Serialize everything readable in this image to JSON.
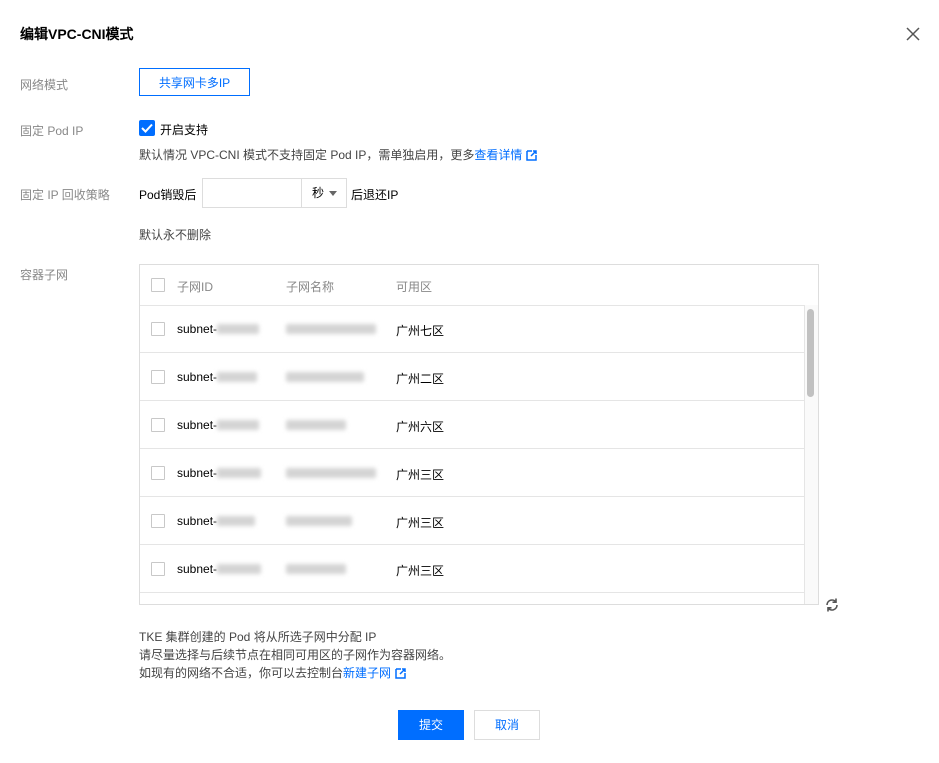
{
  "dialog": {
    "title": "编辑VPC-CNI模式",
    "close_icon": "close-icon"
  },
  "network_mode": {
    "label": "网络模式",
    "option": "共享网卡多IP"
  },
  "fixed_ip": {
    "label": "固定 Pod IP",
    "checkbox_label": "开启支持",
    "checked": true,
    "help_text": "默认情况 VPC-CNI 模式不支持固定 Pod IP，需单独启用，更多",
    "help_link": "查看详情"
  },
  "ip_recycle": {
    "label": "固定 IP 回收策略",
    "prefix": "Pod销毁后",
    "value": "",
    "unit": "秒",
    "suffix": "后退还IP",
    "default_note": "默认永不删除"
  },
  "subnet": {
    "label": "容器子网",
    "columns": [
      "子网ID",
      "子网名称",
      "可用区"
    ],
    "rows": [
      {
        "id_prefix": "subnet-",
        "zone": "广州七区"
      },
      {
        "id_prefix": "subnet-",
        "zone": "广州二区"
      },
      {
        "id_prefix": "subnet-",
        "zone": "广州六区"
      },
      {
        "id_prefix": "subnet-",
        "zone": "广州三区"
      },
      {
        "id_prefix": "subnet-",
        "zone": "广州三区"
      },
      {
        "id_prefix": "subnet-",
        "zone": "广州三区"
      }
    ]
  },
  "info": {
    "line1": "TKE 集群创建的 Pod 将从所选子网中分配 IP",
    "line2": "请尽量选择与后续节点在相同可用区的子网作为容器网络。",
    "line3": "如现有的网络不合适，你可以去控制台",
    "line3_link": "新建子网"
  },
  "actions": {
    "submit": "提交",
    "cancel": "取消"
  },
  "colors": {
    "accent": "#006eff",
    "label_gray": "#888888"
  }
}
